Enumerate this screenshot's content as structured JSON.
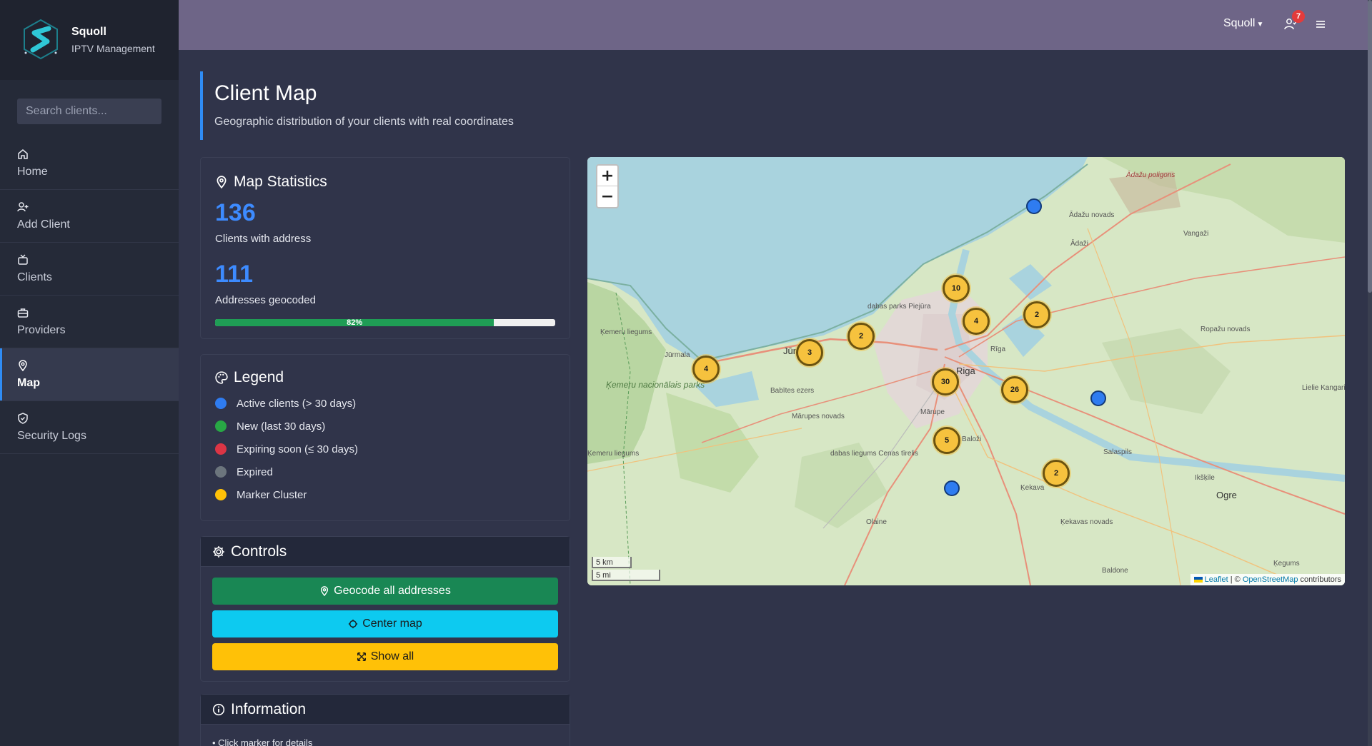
{
  "brand": {
    "name": "Squoll",
    "subtitle": "IPTV Management"
  },
  "search": {
    "placeholder": "Search clients..."
  },
  "sidebar": {
    "items": [
      {
        "label": "Home",
        "icon": "home-icon"
      },
      {
        "label": "Add Client",
        "icon": "add-user-icon"
      },
      {
        "label": "Clients",
        "icon": "tv-icon"
      },
      {
        "label": "Providers",
        "icon": "briefcase-icon"
      },
      {
        "label": "Map",
        "icon": "map-pin-icon",
        "active": true
      },
      {
        "label": "Security Logs",
        "icon": "shield-icon"
      }
    ]
  },
  "topbar": {
    "user": "Squoll",
    "notification_count": "7"
  },
  "page": {
    "title": "Client Map",
    "subtitle": "Geographic distribution of your clients with real coordinates"
  },
  "stats": {
    "title": "Map Statistics",
    "clients_count": "136",
    "clients_label": "Clients with address",
    "geocoded_count": "111",
    "geocoded_label": "Addresses geocoded",
    "progress_label": "82%",
    "progress_value": 0.82
  },
  "legend": {
    "title": "Legend",
    "items": [
      {
        "label": "Active clients (> 30 days)",
        "color": "#2f7cf0"
      },
      {
        "label": "New (last 30 days)",
        "color": "#28a745"
      },
      {
        "label": "Expiring soon (≤ 30 days)",
        "color": "#dc3545"
      },
      {
        "label": "Expired",
        "color": "#6c757d"
      },
      {
        "label": "Marker Cluster",
        "color": "#ffc107"
      }
    ]
  },
  "controls": {
    "title": "Controls",
    "geocode_label": "Geocode all addresses",
    "center_label": "Center map",
    "show_all_label": "Show all"
  },
  "information": {
    "title": "Information",
    "first_line": "• Click marker for details"
  },
  "map": {
    "zoom_in": "+",
    "zoom_out": "−",
    "scale_km": "5 km",
    "scale_mi": "5 mi",
    "attribution_leaflet": "Leaflet",
    "attribution_sep": " | © ",
    "attribution_osm": "OpenStreetMap",
    "attribution_tail": " contributors",
    "clusters": [
      "4",
      "3",
      "2",
      "10",
      "4",
      "2",
      "30",
      "26",
      "5",
      "2"
    ],
    "labels": {
      "riga": "Riga",
      "jurmala": "Jūrmala",
      "jur": "Jūr",
      "ogre": "Ogre",
      "salaspils": "Salaspils",
      "adazi": "Ādaži",
      "adazu_novads": "Ādažu novads",
      "adazu_poligons": "Ādažu poligons",
      "vangazi": "Vangaži",
      "ropazu": "Ropažu novads",
      "marupe": "Mārupe",
      "marupes_novads": "Mārupes novads",
      "balozi": "Baloži",
      "kekava": "Ķekava",
      "kekavas_novads": "Ķekavas novads",
      "olaine": "Olaine",
      "ikskile": "Ikšķile",
      "baldone": "Baldone",
      "kegums": "Ķegums",
      "lielie_kangari": "Lielie Kangari",
      "kemeru_liegums": "Ķemeru liegums",
      "kemeru_parks": "Ķemeru nacionālais parks",
      "kemeru_liegums2": "Ķemeru liegums",
      "babites_ezers": "Babītes ezers",
      "dabas_parks": "dabas parks Piejūra",
      "dabas_liegums": "dabas liegums Cenas tīrelis",
      "riga_small": "Rīga"
    }
  }
}
